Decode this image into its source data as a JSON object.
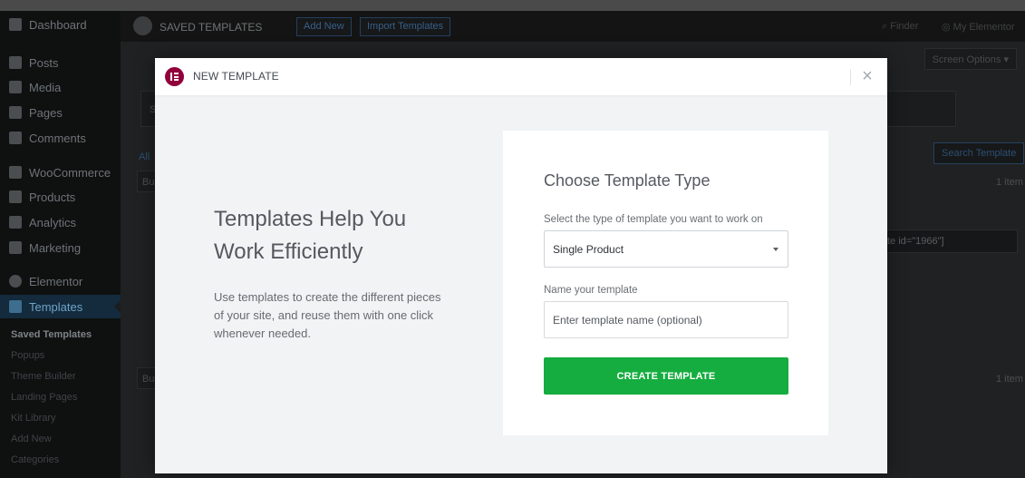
{
  "sidebar": {
    "items": [
      {
        "label": "Dashboard",
        "icon": "dashboard-icon"
      },
      {
        "label": "Posts",
        "icon": "pin-icon"
      },
      {
        "label": "Media",
        "icon": "media-icon"
      },
      {
        "label": "Pages",
        "icon": "page-icon"
      },
      {
        "label": "Comments",
        "icon": "comment-icon"
      },
      {
        "label": "WooCommerce",
        "icon": "woocommerce-icon"
      },
      {
        "label": "Products",
        "icon": "products-icon"
      },
      {
        "label": "Analytics",
        "icon": "analytics-icon"
      },
      {
        "label": "Marketing",
        "icon": "megaphone-icon"
      },
      {
        "label": "Elementor",
        "icon": "elementor-icon"
      },
      {
        "label": "Templates",
        "icon": "folder-icon"
      }
    ],
    "submenu": [
      "Saved Templates",
      "Popups",
      "Theme Builder",
      "Landing Pages",
      "Kit Library",
      "Add New",
      "Categories"
    ]
  },
  "header": {
    "title": "SAVED TEMPLATES",
    "add_new": "Add New",
    "import": "Import Templates",
    "finder": "Finder",
    "my_elementor": "My Elementor",
    "screen_options": "Screen Options ▾"
  },
  "background": {
    "filter_all": "All",
    "bulk": "Bu",
    "search_button": "Search Template",
    "items_count": "1 item",
    "shortcode_fragment": "te id=\"1966\"]",
    "s_fragment": "S"
  },
  "modal": {
    "title": "NEW TEMPLATE",
    "close": "×",
    "headline_line1": "Templates Help You",
    "headline_line2": "Work Efficiently",
    "description": "Use templates to create the different pieces of your site, and reuse them with one click whenever needed.",
    "form": {
      "title": "Choose Template Type",
      "type_label": "Select the type of template you want to work on",
      "type_value": "Single Product",
      "name_label": "Name your template",
      "name_placeholder": "Enter template name (optional)",
      "submit": "CREATE TEMPLATE"
    }
  },
  "colors": {
    "elementor_brand": "#92003b",
    "create_button": "#15ad3f",
    "wp_admin_active": "#2271b1"
  }
}
